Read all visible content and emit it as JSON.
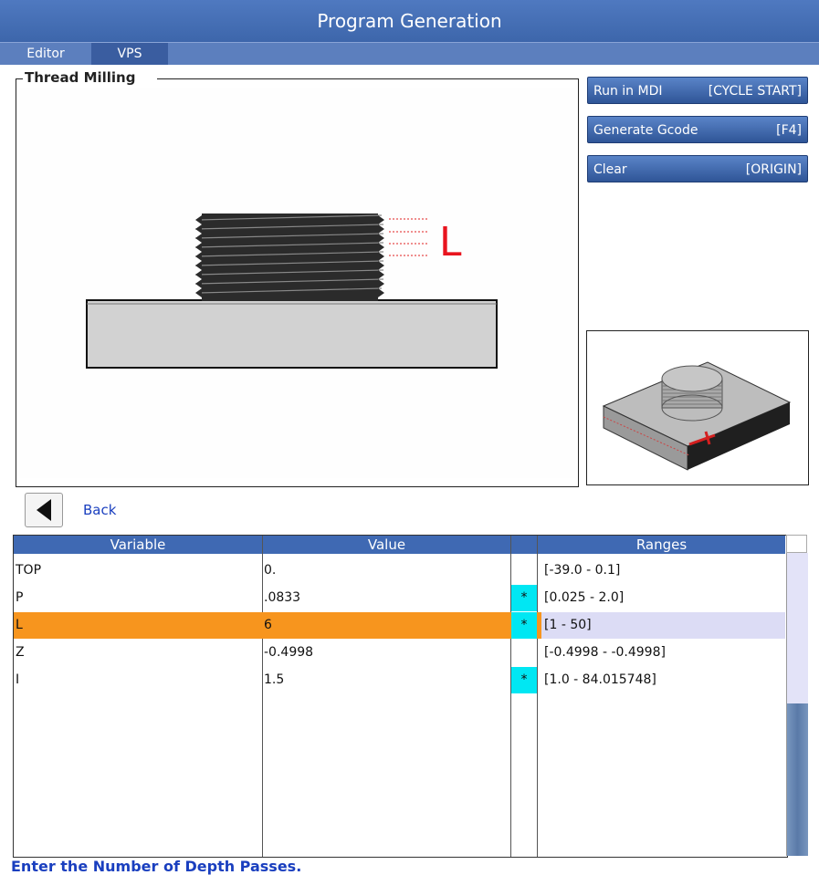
{
  "window": {
    "title": "Program Generation"
  },
  "tabs": [
    {
      "label": "Editor"
    },
    {
      "label": "VPS"
    }
  ],
  "panel": {
    "title": "Thread Milling",
    "dimension_label": "L"
  },
  "buttons": [
    {
      "label": "Run in MDI",
      "key": "[CYCLE START]"
    },
    {
      "label": "Generate Gcode",
      "key": "[F4]"
    },
    {
      "label": "Clear",
      "key": "[ORIGIN]"
    }
  ],
  "nav": {
    "back_label": "Back"
  },
  "table": {
    "headers": {
      "variable": "Variable",
      "value": "Value",
      "ranges": "Ranges"
    },
    "rows": [
      {
        "variable": "TOP",
        "value": "0.",
        "flag": "",
        "range": "[-39.0 - 0.1]"
      },
      {
        "variable": "P",
        "value": ".0833",
        "flag": "*",
        "range": "[0.025 - 2.0]"
      },
      {
        "variable": "L",
        "value": "6",
        "flag": "*",
        "range": "[1 - 50]",
        "selected": true
      },
      {
        "variable": "Z",
        "value": "-0.4998",
        "flag": "",
        "range": "[-0.4998 - -0.4998]"
      },
      {
        "variable": "I",
        "value": "1.5",
        "flag": "*",
        "range": "[1.0 - 84.015748]"
      }
    ]
  },
  "status": {
    "message": "Enter the Number of Depth Passes."
  },
  "colors": {
    "titlebar": "#4570b8",
    "selected_row": "#f7951e",
    "required_flag": "#00e7f3",
    "link": "#1a3fbf"
  }
}
